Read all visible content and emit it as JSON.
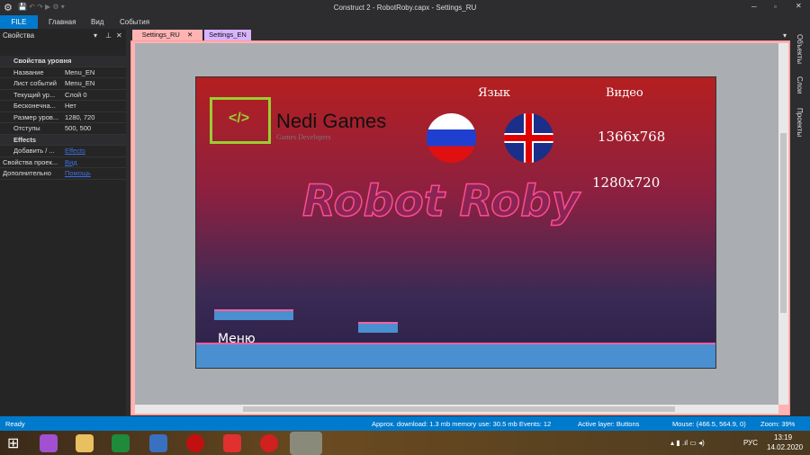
{
  "window": {
    "title": "Construct 2 - RobotRoby.capx - Settings_RU"
  },
  "menu": {
    "file": "FILE",
    "items": [
      "Главная",
      "Вид",
      "События"
    ]
  },
  "panel": {
    "title": "Свойства",
    "rows": [
      {
        "key": "Свойства уровня",
        "value": "",
        "section": true
      },
      {
        "key": "Название",
        "value": "Menu_EN"
      },
      {
        "key": "Лист событий",
        "value": "Menu_EN"
      },
      {
        "key": "Текущий ур...",
        "value": "Слой 0"
      },
      {
        "key": "Бесконечна...",
        "value": "Нет"
      },
      {
        "key": "Размер уров...",
        "value": "1280, 720"
      },
      {
        "key": "Отступы",
        "value": "500, 500"
      },
      {
        "key": "Effects",
        "value": "",
        "section": true
      },
      {
        "key": "Добавить / ...",
        "value": "Effects",
        "link": true
      },
      {
        "key": "Свойства проек...",
        "value": "Вид",
        "link": true,
        "top": true
      },
      {
        "key": "Дополнительно",
        "value": "Помощь",
        "link": true,
        "top": true
      }
    ]
  },
  "tabs": [
    {
      "label": "Settings_RU",
      "color": "#ffb3b3"
    },
    {
      "label": "Settings_EN",
      "color": "#d9b3ff"
    }
  ],
  "right_tabs": [
    "Объекты",
    "Слои",
    "Проекты"
  ],
  "game": {
    "logo_title": "Nedi Games",
    "logo_subtitle": "Games Developers",
    "lang_label": "Язык",
    "video_label": "Видео",
    "res1": "1366x768",
    "res2": "1280x720",
    "title": "Robot Roby",
    "menu_label": "Меню"
  },
  "status": {
    "ready": "Ready",
    "download": "Approx. download: 1.3 mb  memory use: 30.5 mb  Events: 12",
    "layer": "Active layer: Buttons",
    "mouse": "Mouse: (466.5, 564.9, 0)",
    "zoom": "Zoom: 39%"
  },
  "taskbar": {
    "lang": "РУС",
    "time": "13:19",
    "date": "14.02.2020"
  },
  "colors": {
    "accent": "#007acc",
    "tab_ru": "#ffb3b3",
    "tab_en": "#d9b3ff"
  }
}
